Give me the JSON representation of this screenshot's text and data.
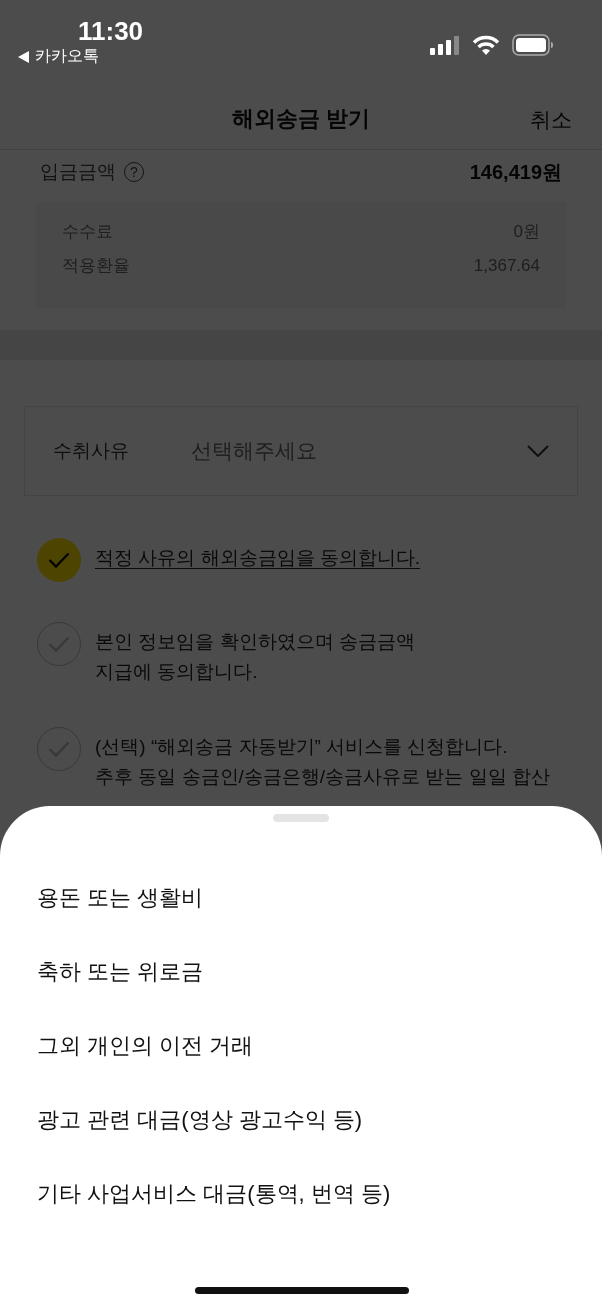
{
  "status_bar": {
    "time": "11:30",
    "back_app": "카카오톡"
  },
  "header": {
    "title": "해외송금 받기",
    "cancel": "취소"
  },
  "amount": {
    "label": "입금금액",
    "help": "?",
    "value": "146,419원"
  },
  "details": [
    {
      "label": "수수료",
      "value": "0원"
    },
    {
      "label": "적용환율",
      "value": "1,367.64"
    }
  ],
  "reason_field": {
    "label": "수취사유",
    "placeholder": "선택해주세요"
  },
  "agreements": [
    {
      "kind": "link",
      "text": "적정 사유의 해외송금임을 동의합니다.",
      "checked": true
    },
    {
      "kind": "plain",
      "text": "본인 정보임을 확인하였으며 송금금액\n지급에 동의합니다.",
      "checked": false
    },
    {
      "kind": "plain",
      "text": "(선택) “해외송금 자동받기” 서비스를 신청합니다.\n추후 동일 송금인/송금은행/송금사유로 받는 일일 합산",
      "checked": false
    }
  ],
  "sheet": {
    "options": [
      "용돈 또는 생활비",
      "축하 또는 위로금",
      "그외 개인의 이전 거래",
      "광고 관련 대금(영상 광고수익 등)",
      "기타 사업서비스 대금(통역, 번역 등)"
    ]
  }
}
